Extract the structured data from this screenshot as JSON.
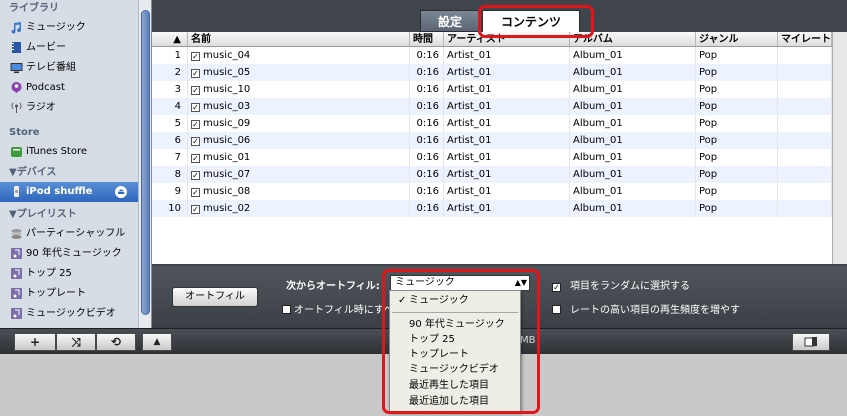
{
  "sidebar": {
    "library_header": "ライブラリ",
    "library_items": [
      {
        "label": "ミュージック",
        "icon": "music-note-icon"
      },
      {
        "label": "ムービー",
        "icon": "movie-icon"
      },
      {
        "label": "テレビ番組",
        "icon": "tv-icon"
      },
      {
        "label": "Podcast",
        "icon": "podcast-icon"
      },
      {
        "label": "ラジオ",
        "icon": "radio-icon"
      }
    ],
    "store_header": "Store",
    "store_items": [
      {
        "label": "iTunes Store",
        "icon": "store-icon"
      }
    ],
    "devices_header": "▼デバイス",
    "device": {
      "label": "iPod shuffle",
      "icon": "ipod-icon",
      "eject_icon": "eject-icon"
    },
    "playlists_header": "▼プレイリスト",
    "playlist_items": [
      {
        "label": "パーティーシャッフル",
        "icon": "party-shuffle-icon"
      },
      {
        "label": "90 年代ミュージック",
        "icon": "smart-playlist-icon"
      },
      {
        "label": "トップ 25",
        "icon": "smart-playlist-icon"
      },
      {
        "label": "トップレート",
        "icon": "smart-playlist-icon"
      },
      {
        "label": "ミュージックビデオ",
        "icon": "smart-playlist-icon"
      }
    ]
  },
  "toolbar": {
    "add_symbol": "+",
    "shuffle_symbol": "⤨",
    "repeat_symbol": "⟲",
    "artwork_symbol": "▲",
    "capacity_suffix": "MB",
    "device_icon": "ipod-display-icon"
  },
  "tabs": {
    "settings": "設定",
    "contents": "コンテンツ"
  },
  "table": {
    "sort_indicator": "▲",
    "headers": {
      "name": "名前",
      "time": "時間",
      "artist": "アーティスト",
      "album": "アルバム",
      "genre": "ジャンル",
      "rating": "マイレート"
    },
    "rows": [
      {
        "num": "1",
        "name": "music_04",
        "time": "0:16",
        "artist": "Artist_01",
        "album": "Album_01",
        "genre": "Pop"
      },
      {
        "num": "2",
        "name": "music_05",
        "time": "0:16",
        "artist": "Artist_01",
        "album": "Album_01",
        "genre": "Pop"
      },
      {
        "num": "3",
        "name": "music_10",
        "time": "0:16",
        "artist": "Artist_01",
        "album": "Album_01",
        "genre": "Pop"
      },
      {
        "num": "4",
        "name": "music_03",
        "time": "0:16",
        "artist": "Artist_01",
        "album": "Album_01",
        "genre": "Pop"
      },
      {
        "num": "5",
        "name": "music_09",
        "time": "0:16",
        "artist": "Artist_01",
        "album": "Album_01",
        "genre": "Pop"
      },
      {
        "num": "6",
        "name": "music_06",
        "time": "0:16",
        "artist": "Artist_01",
        "album": "Album_01",
        "genre": "Pop"
      },
      {
        "num": "7",
        "name": "music_01",
        "time": "0:16",
        "artist": "Artist_01",
        "album": "Album_01",
        "genre": "Pop"
      },
      {
        "num": "8",
        "name": "music_07",
        "time": "0:16",
        "artist": "Artist_01",
        "album": "Album_01",
        "genre": "Pop"
      },
      {
        "num": "9",
        "name": "music_08",
        "time": "0:16",
        "artist": "Artist_01",
        "album": "Album_01",
        "genre": "Pop"
      },
      {
        "num": "10",
        "name": "music_02",
        "time": "0:16",
        "artist": "Artist_01",
        "album": "Album_01",
        "genre": "Pop"
      }
    ]
  },
  "options": {
    "autofill_button": "オートフィル",
    "autofill_from_label": "次からオートフィル:",
    "source_value": "ミュージック",
    "replace_label": "オートフィル時にすべ",
    "random_label": "項目をランダムに選択する",
    "random_checked": true,
    "weight_label": "レートの高い項目の再生頻度を増やす",
    "weight_checked": false
  },
  "dropdown": {
    "selected_mark": "✓",
    "items": [
      "ミュージック",
      "90 年代ミュージック",
      "トップ 25",
      "トップレート",
      "ミュージックビデオ",
      "最近再生した項目",
      "最近追加した項目"
    ]
  },
  "colors": {
    "highlight": "#e0161b",
    "selection": "#2f66bb"
  }
}
